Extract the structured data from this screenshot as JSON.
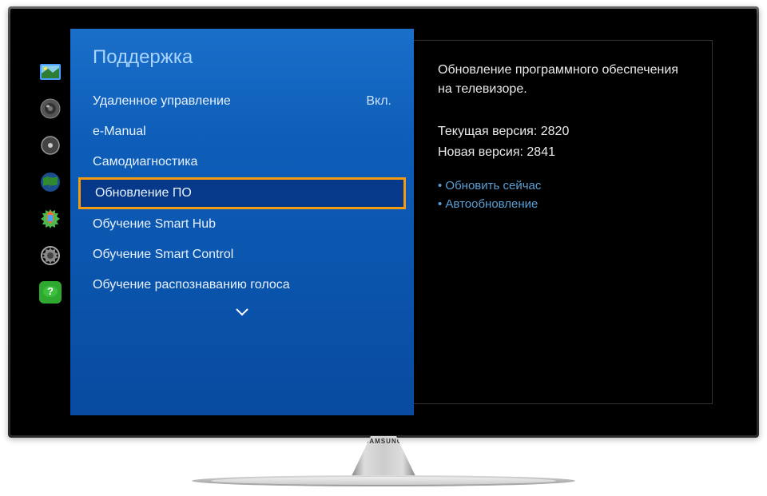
{
  "panel": {
    "title": "Поддержка"
  },
  "menu": {
    "items": [
      {
        "label": "Удаленное управление",
        "value": "Вкл."
      },
      {
        "label": "e-Manual",
        "value": ""
      },
      {
        "label": "Самодиагностика",
        "value": ""
      },
      {
        "label": "Обновление ПО",
        "value": ""
      },
      {
        "label": "Обучение Smart Hub",
        "value": ""
      },
      {
        "label": "Обучение Smart Control",
        "value": ""
      },
      {
        "label": "Обучение распознаванию голоса",
        "value": ""
      }
    ]
  },
  "info": {
    "description": "Обновление программного обеспечения на телевизоре.",
    "current_version_label": "Текущая версия:",
    "current_version_value": "2820",
    "new_version_label": "Новая версия:",
    "new_version_value": "2841",
    "actions": [
      "Обновить сейчас",
      "Автообновление"
    ]
  },
  "brand": "SAMSUNG"
}
